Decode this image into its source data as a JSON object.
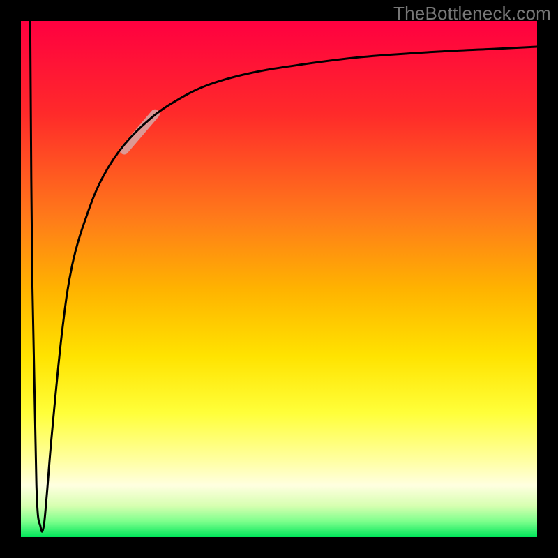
{
  "watermark": "TheBottleneck.com",
  "colors": {
    "background": "#000000",
    "frame": "#000000",
    "watermark": "#777777",
    "gradient_stops": [
      {
        "offset": 0.0,
        "color": "#ff0040"
      },
      {
        "offset": 0.18,
        "color": "#ff2a2a"
      },
      {
        "offset": 0.38,
        "color": "#ff7a1a"
      },
      {
        "offset": 0.52,
        "color": "#ffb300"
      },
      {
        "offset": 0.65,
        "color": "#ffe300"
      },
      {
        "offset": 0.76,
        "color": "#ffff3a"
      },
      {
        "offset": 0.85,
        "color": "#ffffa0"
      },
      {
        "offset": 0.9,
        "color": "#ffffe0"
      },
      {
        "offset": 0.94,
        "color": "#d6ffb0"
      },
      {
        "offset": 0.97,
        "color": "#7cff8c"
      },
      {
        "offset": 1.0,
        "color": "#00e65a"
      }
    ],
    "curve": "#000000",
    "highlight": "#d8a3a1"
  },
  "chart_data": {
    "type": "line",
    "title": "",
    "xlabel": "",
    "ylabel": "",
    "xlim": [
      0,
      100
    ],
    "ylim": [
      0,
      100
    ],
    "grid": false,
    "legend": false,
    "series": [
      {
        "name": "bottleneck-curve",
        "x": [
          1.8,
          2.2,
          3.0,
          3.8,
          4.4,
          5.0,
          6.0,
          8.0,
          10.0,
          13.0,
          16.0,
          20.0,
          25.0,
          30.0,
          36.0,
          44.0,
          54.0,
          66.0,
          80.0,
          92.0,
          100.0
        ],
        "y": [
          100.0,
          50.0,
          10.0,
          2.0,
          2.0,
          8.0,
          20.0,
          40.0,
          53.0,
          63.0,
          70.0,
          76.0,
          81.0,
          84.5,
          87.5,
          89.8,
          91.5,
          93.0,
          94.0,
          94.6,
          95.0
        ]
      }
    ],
    "highlight_segment": {
      "series": "bottleneck-curve",
      "x_range": [
        20.0,
        26.0
      ],
      "y_range": [
        75.0,
        82.0
      ]
    }
  }
}
